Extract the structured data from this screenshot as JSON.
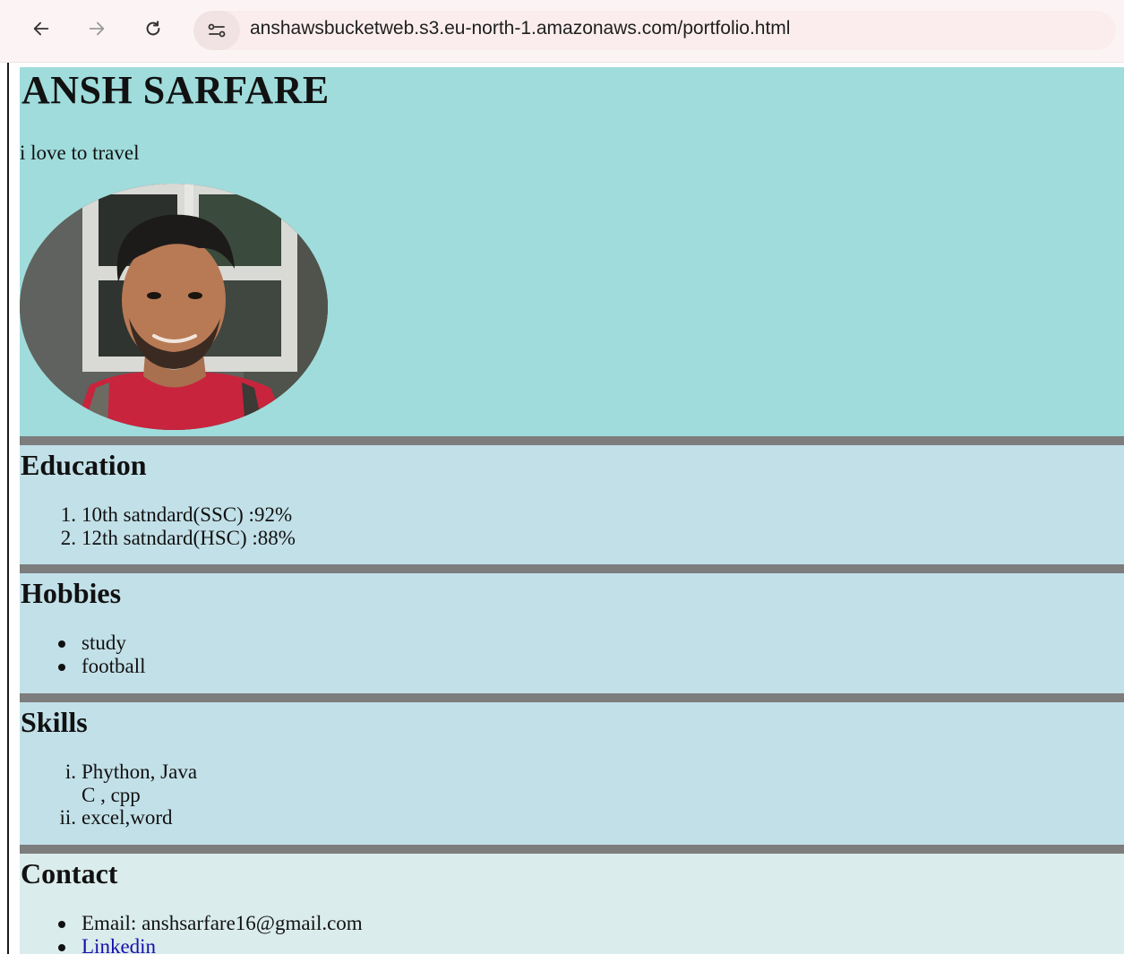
{
  "browser": {
    "url": "anshawsbucketweb.s3.eu-north-1.amazonaws.com/portfolio.html",
    "icons": [
      "back-arrow-icon",
      "forward-arrow-icon",
      "reload-icon",
      "site-info-icon"
    ]
  },
  "header": {
    "name": "ANSH SARFARE",
    "tagline": "i love to travel",
    "background": "#a0dcdc"
  },
  "education": {
    "title": "Education",
    "items": [
      {
        "marker": "1.",
        "text": "10th satndard(SSC) :92%"
      },
      {
        "marker": "2.",
        "text": "12th satndard(HSC) :88%"
      }
    ]
  },
  "hobbies": {
    "title": "Hobbies",
    "items": [
      "study",
      "football"
    ]
  },
  "skills": {
    "title": "Skills",
    "items": [
      {
        "marker": "i.",
        "lines": [
          "Phython, Java",
          "C , cpp"
        ]
      },
      {
        "marker": "ii.",
        "lines": [
          "excel,word"
        ]
      }
    ]
  },
  "contact": {
    "title": "Contact",
    "email": "Email: anshsarfare16@gmail.com",
    "linkedin": "Linkedin"
  },
  "colors": {
    "header_bg": "#a0dcdc",
    "section_bg": "#c2e0e8",
    "contact_bg": "#daeceb",
    "separator": "#7d7d7d",
    "link": "#1a0dab"
  }
}
